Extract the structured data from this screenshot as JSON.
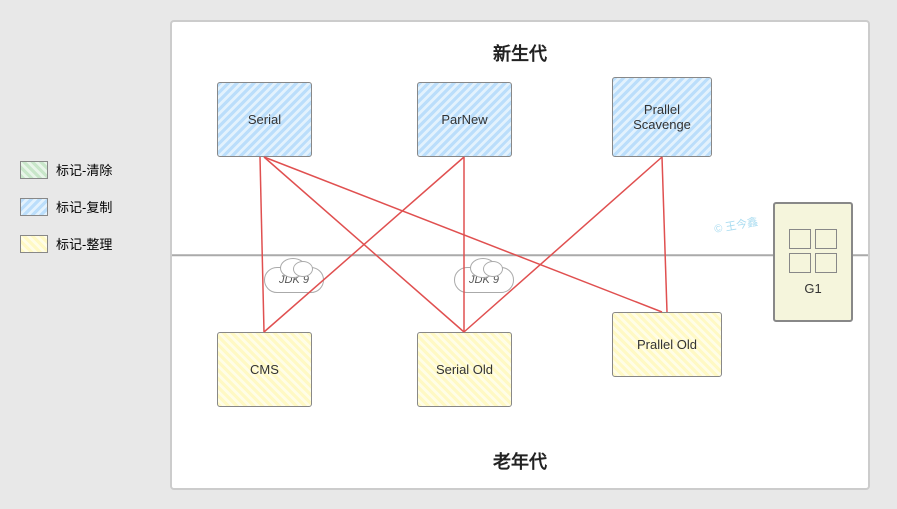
{
  "legend": {
    "items": [
      {
        "id": "clear",
        "label": "标记-清除",
        "type": "green"
      },
      {
        "id": "copy",
        "label": "标记-复制",
        "type": "blue"
      },
      {
        "id": "compact",
        "label": "标记-整理",
        "type": "yellow"
      }
    ]
  },
  "diagram": {
    "young_label": "新生代",
    "old_label": "老年代",
    "collectors": {
      "serial": "Serial",
      "parnew": "ParNew",
      "prallel_scavenge": "Prallel\nScavenge",
      "cms": "CMS",
      "serial_old": "Serial Old",
      "prallel_old": "Prallel Old",
      "g1": "G1"
    },
    "jdk_labels": {
      "jdk1": "JDK 9",
      "jdk2": "JDK 9"
    },
    "watermark": "© 王今鑫"
  }
}
